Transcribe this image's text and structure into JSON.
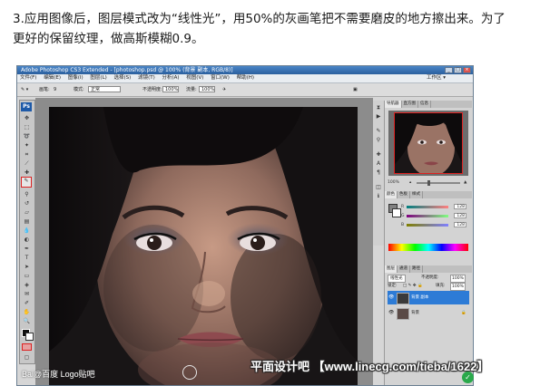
{
  "tutorial": {
    "line1": "3.应用图像后，图层模式改为“线性光”，用50%的灰画笔把不需要磨皮的地方擦出来。为了",
    "line2": "更好的保留纹理，做高斯模糊0.9。"
  },
  "window": {
    "title": "Adobe Photoshop CS3 Extended - [photoshop.psd @ 100% (背景 副本, RGB/8)]",
    "minimize": "_",
    "maximize": "□",
    "close": "×"
  },
  "menubar": {
    "items": [
      "文件(F)",
      "编辑(E)",
      "图像(I)",
      "图层(L)",
      "选择(S)",
      "滤镜(T)",
      "分析(A)",
      "视图(V)",
      "窗口(W)",
      "帮助(H)"
    ],
    "workspace": "工作区 ▾"
  },
  "options": {
    "brush_label": "画笔:",
    "brush_size": "9",
    "mode_label": "模式:",
    "mode_value": "正常",
    "opacity_label": "不透明度:",
    "opacity_value": "100%",
    "flow_label": "流量:",
    "flow_value": "100%"
  },
  "tools": {
    "logo": "Ps"
  },
  "panels": {
    "navigator_tabs": [
      "导航器",
      "直方图",
      "信息"
    ],
    "zoom": "100%",
    "color_tabs": [
      "颜色",
      "色板",
      "样式"
    ],
    "sliders": [
      {
        "channel": "R",
        "value": "128",
        "color_start": "#008080",
        "color_end": "#ff8080"
      },
      {
        "channel": "G",
        "value": "128",
        "color_start": "#800080",
        "color_end": "#80ff80"
      },
      {
        "channel": "B",
        "value": "128",
        "color_start": "#808000",
        "color_end": "#8080ff"
      }
    ],
    "layers_tabs": [
      "图层",
      "通道",
      "路径"
    ],
    "blend_mode": "线性光",
    "opacity_label": "不透明度:",
    "opacity": "100%",
    "lock_label": "锁定:",
    "fill_label": "填充:",
    "fill": "100%",
    "layers": [
      {
        "name": "背景 副本",
        "selected": true
      },
      {
        "name": "背景",
        "selected": false
      }
    ]
  },
  "watermark": {
    "text": "平面设计吧 【www.linecg.com/tieba/1622】",
    "bottom_logo": "Bai@百度  Logo贴吧"
  },
  "colors": {
    "ps_blue": "#1e5aa8",
    "selected_layer": "#2d7bd6",
    "red_highlight": "#d22222"
  }
}
